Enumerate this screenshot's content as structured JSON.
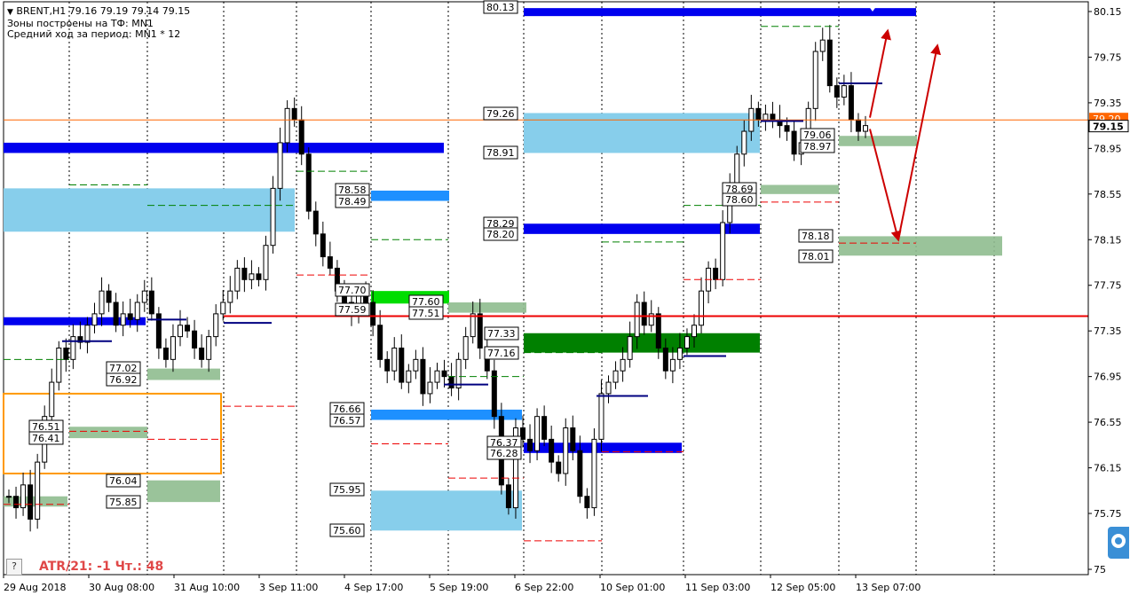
{
  "header": {
    "symbol_line": "BRENT,H1  79.16 79.19 79.14 79.15",
    "zones_line": "Зоны построены на ТФ: MN1",
    "avg_line": "Средний ход за период: MN1 * 12"
  },
  "footer": {
    "help_label": "?",
    "atr_text": "ATR/21: -1  Чт.: 48"
  },
  "colors": {
    "bull_candle": "#000000",
    "bear_candle": "#000000",
    "blue_zone": "#0000ee",
    "light_blue_zone": "#87ceeb",
    "mid_blue_zone": "#1e90ff",
    "green_zone": "#008000",
    "light_green_zone": "#00dd00",
    "gray_green_zone": "#8fbc8f",
    "orange_box": "#ff9900",
    "red_level": "#ee0000",
    "current_price_line": "#ff6600",
    "forecast_arrow": "#cc0000"
  },
  "chart_data": {
    "type": "candlestick",
    "instrument": "BRENT",
    "timeframe": "H1",
    "ohlc_current": {
      "open": 79.16,
      "high": 79.19,
      "low": 79.14,
      "close": 79.15
    },
    "ylim": [
      75.5,
      80.2
    ],
    "y_ticks": [
      "80.15",
      "79.75",
      "79.35",
      "78.95",
      "78.55",
      "78.15",
      "77.75",
      "77.35",
      "76.95",
      "76.55",
      "76.15",
      "75.75",
      "75"
    ],
    "x_ticks": [
      "29 Aug 2018",
      "30 Aug 08:00",
      "31 Aug 10:00",
      "3 Sep 11:00",
      "4 Sep 17:00",
      "5 Sep 19:00",
      "6 Sep 22:00",
      "10 Sep 01:00",
      "11 Sep 03:00",
      "12 Sep 05:00",
      "13 Sep 07:00"
    ],
    "current_price": 79.15,
    "current_price_label": "79.15",
    "hidden_price_label": "79.20",
    "price_path": [
      75.9,
      75.8,
      76.0,
      75.7,
      76.2,
      76.6,
      76.9,
      77.2,
      77.1,
      77.3,
      77.25,
      77.4,
      77.5,
      77.7,
      77.6,
      77.4,
      77.5,
      77.45,
      77.6,
      77.7,
      77.5,
      77.2,
      77.1,
      77.3,
      77.4,
      77.35,
      77.2,
      77.1,
      77.3,
      77.5,
      77.6,
      77.7,
      77.9,
      77.8,
      77.85,
      77.8,
      78.1,
      78.6,
      79.0,
      79.3,
      79.2,
      78.9,
      78.4,
      78.2,
      78.0,
      77.9,
      77.7,
      77.6,
      77.5,
      77.7,
      77.6,
      77.4,
      77.1,
      77.0,
      77.2,
      76.9,
      77.0,
      77.1,
      76.8,
      76.9,
      77.0,
      76.95,
      76.85,
      77.1,
      77.3,
      77.5,
      77.2,
      77.0,
      76.6,
      76.0,
      75.8,
      76.5,
      76.4,
      76.3,
      76.6,
      76.4,
      76.2,
      76.1,
      76.5,
      76.3,
      75.9,
      75.8,
      76.4,
      76.8,
      76.9,
      77.0,
      77.1,
      77.3,
      77.6,
      77.4,
      77.5,
      77.2,
      77.0,
      77.1,
      77.2,
      77.3,
      77.4,
      77.7,
      77.9,
      77.8,
      78.3,
      78.6,
      78.9,
      79.1,
      79.3,
      79.2,
      79.25,
      79.2,
      79.15,
      79.1,
      78.9,
      79.0,
      79.3,
      79.8,
      79.9,
      79.5,
      79.4,
      79.5,
      79.2,
      79.1,
      79.15
    ],
    "forecast": {
      "down_target": 78.15,
      "up_target": 80.15
    },
    "levels": [
      {
        "label": "80.13",
        "price": 80.13,
        "kind": "blue"
      },
      {
        "label": "79.26",
        "price": 79.26,
        "kind": "lightblue-top"
      },
      {
        "label": "78.91",
        "price": 78.91,
        "kind": "lightblue-bottom"
      },
      {
        "label": "79.06",
        "price": 79.06,
        "kind": "graygreen-top"
      },
      {
        "label": "78.97",
        "price": 78.97,
        "kind": "graygreen-bottom"
      },
      {
        "label": "78.29",
        "price": 78.29,
        "kind": "blue"
      },
      {
        "label": "78.20",
        "price": 78.2,
        "kind": "blue"
      },
      {
        "label": "78.18",
        "price": 78.18,
        "kind": "graygreen"
      },
      {
        "label": "78.01",
        "price": 78.01,
        "kind": "graygreen"
      },
      {
        "label": "78.69",
        "price": 78.69,
        "kind": "graygreen"
      },
      {
        "label": "78.60",
        "price": 78.6,
        "kind": "graygreen"
      },
      {
        "label": "78.58",
        "price": 78.58,
        "kind": "midblue"
      },
      {
        "label": "78.49",
        "price": 78.49,
        "kind": "midblue"
      },
      {
        "label": "77.70",
        "price": 77.7,
        "kind": "green"
      },
      {
        "label": "77.59",
        "price": 77.59,
        "kind": "green"
      },
      {
        "label": "77.60",
        "price": 77.6,
        "kind": "graygreen"
      },
      {
        "label": "77.51",
        "price": 77.51,
        "kind": "graygreen"
      },
      {
        "label": "77.33",
        "price": 77.33,
        "kind": "darkgreen"
      },
      {
        "label": "77.16",
        "price": 77.16,
        "kind": "darkgreen"
      },
      {
        "label": "77.02",
        "price": 77.02,
        "kind": "graygreen"
      },
      {
        "label": "76.92",
        "price": 76.92,
        "kind": "graygreen"
      },
      {
        "label": "76.66",
        "price": 76.66,
        "kind": "midblue"
      },
      {
        "label": "76.57",
        "price": 76.57,
        "kind": "midblue"
      },
      {
        "label": "76.51",
        "price": 76.51,
        "kind": "graygreen"
      },
      {
        "label": "76.41",
        "price": 76.41,
        "kind": "graygreen"
      },
      {
        "label": "76.37",
        "price": 76.37,
        "kind": "blue"
      },
      {
        "label": "76.28",
        "price": 76.28,
        "kind": "blue"
      },
      {
        "label": "76.04",
        "price": 76.04,
        "kind": "graygreen"
      },
      {
        "label": "75.85",
        "price": 75.85,
        "kind": "graygreen"
      },
      {
        "label": "75.95",
        "price": 75.95,
        "kind": "lightblue"
      },
      {
        "label": "75.60",
        "price": 75.6,
        "kind": "lightblue"
      }
    ]
  }
}
